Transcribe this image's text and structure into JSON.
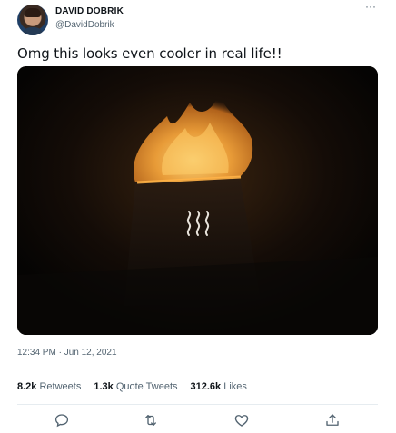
{
  "author": {
    "display_name": "DAVID DOBRIK",
    "handle": "@DavidDobrik",
    "avatar_icon": "user-avatar"
  },
  "more_icon": "more-horizontal-icon",
  "more_glyph": "···",
  "tweet": {
    "text": "Omg this looks even cooler in real life!!",
    "timestamp": "12:34 PM · Jun 12, 2021"
  },
  "stats": {
    "retweets_count": "8.2k",
    "retweets_label": "Retweets",
    "quote_count": "1.3k",
    "quote_label": "Quote Tweets",
    "likes_count": "312.6k",
    "likes_label": "Likes"
  },
  "actions": [
    "reply-icon",
    "retweet-icon",
    "like-icon",
    "share-icon"
  ],
  "colors": {
    "secondary_text": "#536471",
    "divider": "#e6ecf0",
    "icon": "#536471",
    "flame": "#f2a23a"
  }
}
